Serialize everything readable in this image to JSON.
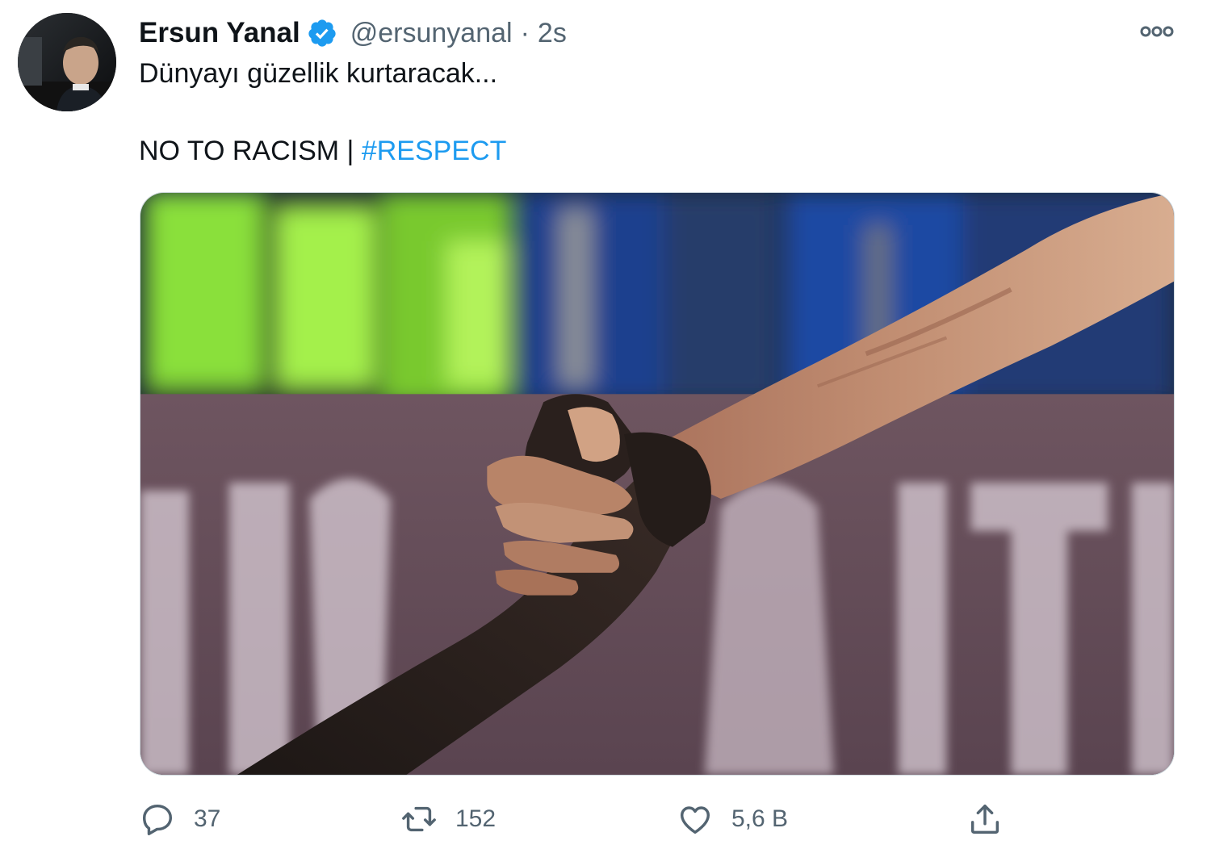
{
  "tweet": {
    "author": {
      "name": "Ersun Yanal",
      "handle": "@ersunyanal",
      "verified": true,
      "avatar_icon": "profile-photo"
    },
    "separator": "·",
    "time": "2s",
    "text_line1": "Dünyayı güzellik kurtaracak...",
    "text_line2_plain": "NO TO RACISM | ",
    "hashtag": "#RESPECT",
    "media": {
      "description_icon": "handshake-photo"
    },
    "more_icon": "more-dots-icon"
  },
  "actions": {
    "reply": {
      "icon": "reply-icon",
      "count": "37"
    },
    "retweet": {
      "icon": "retweet-icon",
      "count": "152"
    },
    "like": {
      "icon": "heart-icon",
      "count": "5,6 B"
    },
    "share": {
      "icon": "share-icon"
    }
  },
  "colors": {
    "link": "#1d9bf0",
    "secondary_text": "#536471",
    "primary_text": "#0f1419",
    "verified_badge": "#1d9bf0"
  }
}
